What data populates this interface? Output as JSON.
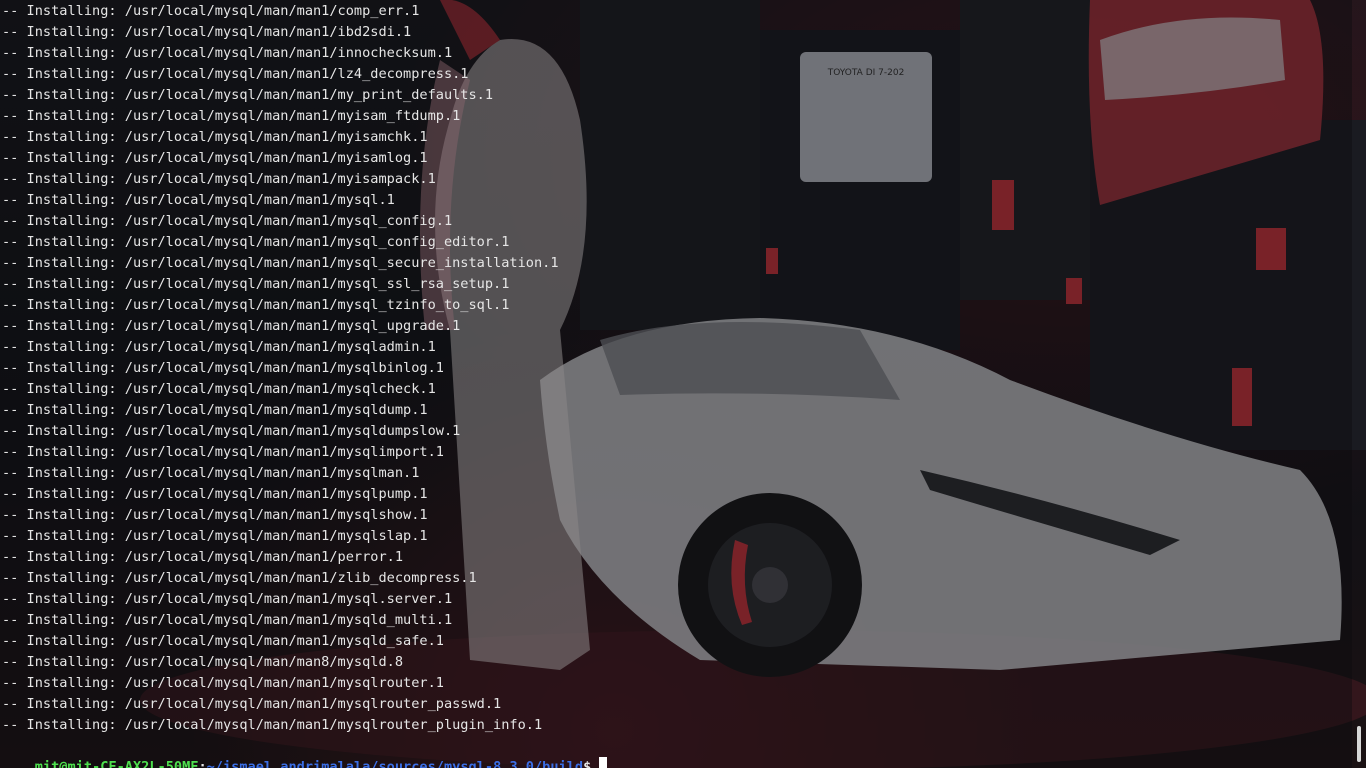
{
  "terminal": {
    "lines": [
      "-- Installing: /usr/local/mysql/man/man1/comp_err.1",
      "-- Installing: /usr/local/mysql/man/man1/ibd2sdi.1",
      "-- Installing: /usr/local/mysql/man/man1/innochecksum.1",
      "-- Installing: /usr/local/mysql/man/man1/lz4_decompress.1",
      "-- Installing: /usr/local/mysql/man/man1/my_print_defaults.1",
      "-- Installing: /usr/local/mysql/man/man1/myisam_ftdump.1",
      "-- Installing: /usr/local/mysql/man/man1/myisamchk.1",
      "-- Installing: /usr/local/mysql/man/man1/myisamlog.1",
      "-- Installing: /usr/local/mysql/man/man1/myisampack.1",
      "-- Installing: /usr/local/mysql/man/man1/mysql.1",
      "-- Installing: /usr/local/mysql/man/man1/mysql_config.1",
      "-- Installing: /usr/local/mysql/man/man1/mysql_config_editor.1",
      "-- Installing: /usr/local/mysql/man/man1/mysql_secure_installation.1",
      "-- Installing: /usr/local/mysql/man/man1/mysql_ssl_rsa_setup.1",
      "-- Installing: /usr/local/mysql/man/man1/mysql_tzinfo_to_sql.1",
      "-- Installing: /usr/local/mysql/man/man1/mysql_upgrade.1",
      "-- Installing: /usr/local/mysql/man/man1/mysqladmin.1",
      "-- Installing: /usr/local/mysql/man/man1/mysqlbinlog.1",
      "-- Installing: /usr/local/mysql/man/man1/mysqlcheck.1",
      "-- Installing: /usr/local/mysql/man/man1/mysqldump.1",
      "-- Installing: /usr/local/mysql/man/man1/mysqldumpslow.1",
      "-- Installing: /usr/local/mysql/man/man1/mysqlimport.1",
      "-- Installing: /usr/local/mysql/man/man1/mysqlman.1",
      "-- Installing: /usr/local/mysql/man/man1/mysqlpump.1",
      "-- Installing: /usr/local/mysql/man/man1/mysqlshow.1",
      "-- Installing: /usr/local/mysql/man/man1/mysqlslap.1",
      "-- Installing: /usr/local/mysql/man/man1/perror.1",
      "-- Installing: /usr/local/mysql/man/man1/zlib_decompress.1",
      "-- Installing: /usr/local/mysql/man/man1/mysql.server.1",
      "-- Installing: /usr/local/mysql/man/man1/mysqld_multi.1",
      "-- Installing: /usr/local/mysql/man/man1/mysqld_safe.1",
      "-- Installing: /usr/local/mysql/man/man8/mysqld.8",
      "-- Installing: /usr/local/mysql/man/man1/mysqlrouter.1",
      "-- Installing: /usr/local/mysql/man/man1/mysqlrouter_passwd.1",
      "-- Installing: /usr/local/mysql/man/man1/mysqlrouter_plugin_info.1"
    ],
    "prompt": {
      "user_host": "mit@mit-CF-AX2L-50MF",
      "separator": ":",
      "path": "~/ismael_andrimalala/sources/mysql-8.3.0/build",
      "symbol": "$"
    }
  },
  "colors": {
    "prompt_user": "#4ee04e",
    "prompt_path": "#3b6fe6",
    "text": "#e6e6e6",
    "accent_red": "#c8323c"
  },
  "wallpaper": {
    "signs": [
      "TOYOTA DI 7-202"
    ]
  },
  "icons": {
    "cursor": "block-cursor",
    "scroll": "scroll-thumb"
  }
}
